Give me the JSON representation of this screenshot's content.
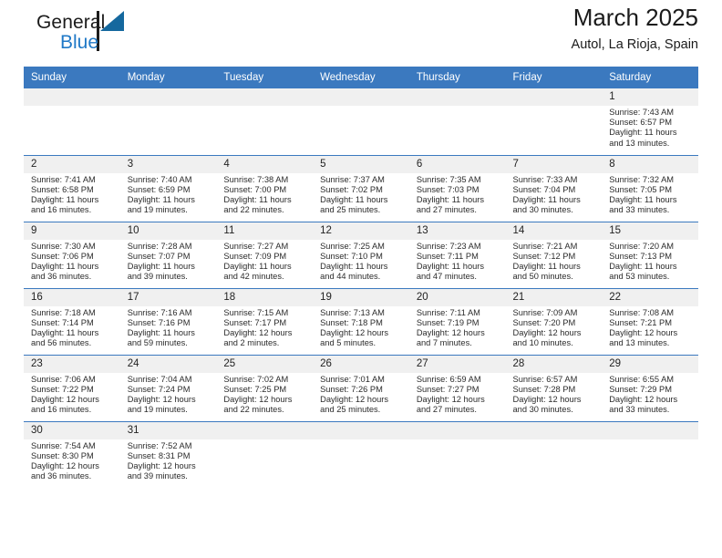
{
  "brand": {
    "name_part1": "General",
    "name_part2": "Blue"
  },
  "header": {
    "title": "March 2025",
    "location": "Autol, La Rioja, Spain"
  },
  "calendar": {
    "weekday_headers": [
      "Sunday",
      "Monday",
      "Tuesday",
      "Wednesday",
      "Thursday",
      "Friday",
      "Saturday"
    ],
    "colors": {
      "header_blue": "#3b79bf",
      "daynum_background": "#f0f0f0",
      "brand_blue": "#2079c7",
      "logo_flag": "#15689e"
    },
    "weeks": [
      [
        {
          "day": "",
          "empty": true
        },
        {
          "day": "",
          "empty": true
        },
        {
          "day": "",
          "empty": true
        },
        {
          "day": "",
          "empty": true
        },
        {
          "day": "",
          "empty": true
        },
        {
          "day": "",
          "empty": true
        },
        {
          "day": "1",
          "sunrise": "Sunrise: 7:43 AM",
          "sunset": "Sunset: 6:57 PM",
          "daylight_line1": "Daylight: 11 hours",
          "daylight_line2": "and 13 minutes."
        }
      ],
      [
        {
          "day": "2",
          "sunrise": "Sunrise: 7:41 AM",
          "sunset": "Sunset: 6:58 PM",
          "daylight_line1": "Daylight: 11 hours",
          "daylight_line2": "and 16 minutes."
        },
        {
          "day": "3",
          "sunrise": "Sunrise: 7:40 AM",
          "sunset": "Sunset: 6:59 PM",
          "daylight_line1": "Daylight: 11 hours",
          "daylight_line2": "and 19 minutes."
        },
        {
          "day": "4",
          "sunrise": "Sunrise: 7:38 AM",
          "sunset": "Sunset: 7:00 PM",
          "daylight_line1": "Daylight: 11 hours",
          "daylight_line2": "and 22 minutes."
        },
        {
          "day": "5",
          "sunrise": "Sunrise: 7:37 AM",
          "sunset": "Sunset: 7:02 PM",
          "daylight_line1": "Daylight: 11 hours",
          "daylight_line2": "and 25 minutes."
        },
        {
          "day": "6",
          "sunrise": "Sunrise: 7:35 AM",
          "sunset": "Sunset: 7:03 PM",
          "daylight_line1": "Daylight: 11 hours",
          "daylight_line2": "and 27 minutes."
        },
        {
          "day": "7",
          "sunrise": "Sunrise: 7:33 AM",
          "sunset": "Sunset: 7:04 PM",
          "daylight_line1": "Daylight: 11 hours",
          "daylight_line2": "and 30 minutes."
        },
        {
          "day": "8",
          "sunrise": "Sunrise: 7:32 AM",
          "sunset": "Sunset: 7:05 PM",
          "daylight_line1": "Daylight: 11 hours",
          "daylight_line2": "and 33 minutes."
        }
      ],
      [
        {
          "day": "9",
          "sunrise": "Sunrise: 7:30 AM",
          "sunset": "Sunset: 7:06 PM",
          "daylight_line1": "Daylight: 11 hours",
          "daylight_line2": "and 36 minutes."
        },
        {
          "day": "10",
          "sunrise": "Sunrise: 7:28 AM",
          "sunset": "Sunset: 7:07 PM",
          "daylight_line1": "Daylight: 11 hours",
          "daylight_line2": "and 39 minutes."
        },
        {
          "day": "11",
          "sunrise": "Sunrise: 7:27 AM",
          "sunset": "Sunset: 7:09 PM",
          "daylight_line1": "Daylight: 11 hours",
          "daylight_line2": "and 42 minutes."
        },
        {
          "day": "12",
          "sunrise": "Sunrise: 7:25 AM",
          "sunset": "Sunset: 7:10 PM",
          "daylight_line1": "Daylight: 11 hours",
          "daylight_line2": "and 44 minutes."
        },
        {
          "day": "13",
          "sunrise": "Sunrise: 7:23 AM",
          "sunset": "Sunset: 7:11 PM",
          "daylight_line1": "Daylight: 11 hours",
          "daylight_line2": "and 47 minutes."
        },
        {
          "day": "14",
          "sunrise": "Sunrise: 7:21 AM",
          "sunset": "Sunset: 7:12 PM",
          "daylight_line1": "Daylight: 11 hours",
          "daylight_line2": "and 50 minutes."
        },
        {
          "day": "15",
          "sunrise": "Sunrise: 7:20 AM",
          "sunset": "Sunset: 7:13 PM",
          "daylight_line1": "Daylight: 11 hours",
          "daylight_line2": "and 53 minutes."
        }
      ],
      [
        {
          "day": "16",
          "sunrise": "Sunrise: 7:18 AM",
          "sunset": "Sunset: 7:14 PM",
          "daylight_line1": "Daylight: 11 hours",
          "daylight_line2": "and 56 minutes."
        },
        {
          "day": "17",
          "sunrise": "Sunrise: 7:16 AM",
          "sunset": "Sunset: 7:16 PM",
          "daylight_line1": "Daylight: 11 hours",
          "daylight_line2": "and 59 minutes."
        },
        {
          "day": "18",
          "sunrise": "Sunrise: 7:15 AM",
          "sunset": "Sunset: 7:17 PM",
          "daylight_line1": "Daylight: 12 hours",
          "daylight_line2": "and 2 minutes."
        },
        {
          "day": "19",
          "sunrise": "Sunrise: 7:13 AM",
          "sunset": "Sunset: 7:18 PM",
          "daylight_line1": "Daylight: 12 hours",
          "daylight_line2": "and 5 minutes."
        },
        {
          "day": "20",
          "sunrise": "Sunrise: 7:11 AM",
          "sunset": "Sunset: 7:19 PM",
          "daylight_line1": "Daylight: 12 hours",
          "daylight_line2": "and 7 minutes."
        },
        {
          "day": "21",
          "sunrise": "Sunrise: 7:09 AM",
          "sunset": "Sunset: 7:20 PM",
          "daylight_line1": "Daylight: 12 hours",
          "daylight_line2": "and 10 minutes."
        },
        {
          "day": "22",
          "sunrise": "Sunrise: 7:08 AM",
          "sunset": "Sunset: 7:21 PM",
          "daylight_line1": "Daylight: 12 hours",
          "daylight_line2": "and 13 minutes."
        }
      ],
      [
        {
          "day": "23",
          "sunrise": "Sunrise: 7:06 AM",
          "sunset": "Sunset: 7:22 PM",
          "daylight_line1": "Daylight: 12 hours",
          "daylight_line2": "and 16 minutes."
        },
        {
          "day": "24",
          "sunrise": "Sunrise: 7:04 AM",
          "sunset": "Sunset: 7:24 PM",
          "daylight_line1": "Daylight: 12 hours",
          "daylight_line2": "and 19 minutes."
        },
        {
          "day": "25",
          "sunrise": "Sunrise: 7:02 AM",
          "sunset": "Sunset: 7:25 PM",
          "daylight_line1": "Daylight: 12 hours",
          "daylight_line2": "and 22 minutes."
        },
        {
          "day": "26",
          "sunrise": "Sunrise: 7:01 AM",
          "sunset": "Sunset: 7:26 PM",
          "daylight_line1": "Daylight: 12 hours",
          "daylight_line2": "and 25 minutes."
        },
        {
          "day": "27",
          "sunrise": "Sunrise: 6:59 AM",
          "sunset": "Sunset: 7:27 PM",
          "daylight_line1": "Daylight: 12 hours",
          "daylight_line2": "and 27 minutes."
        },
        {
          "day": "28",
          "sunrise": "Sunrise: 6:57 AM",
          "sunset": "Sunset: 7:28 PM",
          "daylight_line1": "Daylight: 12 hours",
          "daylight_line2": "and 30 minutes."
        },
        {
          "day": "29",
          "sunrise": "Sunrise: 6:55 AM",
          "sunset": "Sunset: 7:29 PM",
          "daylight_line1": "Daylight: 12 hours",
          "daylight_line2": "and 33 minutes."
        }
      ],
      [
        {
          "day": "30",
          "sunrise": "Sunrise: 7:54 AM",
          "sunset": "Sunset: 8:30 PM",
          "daylight_line1": "Daylight: 12 hours",
          "daylight_line2": "and 36 minutes."
        },
        {
          "day": "31",
          "sunrise": "Sunrise: 7:52 AM",
          "sunset": "Sunset: 8:31 PM",
          "daylight_line1": "Daylight: 12 hours",
          "daylight_line2": "and 39 minutes."
        },
        {
          "day": "",
          "empty": true
        },
        {
          "day": "",
          "empty": true
        },
        {
          "day": "",
          "empty": true
        },
        {
          "day": "",
          "empty": true
        },
        {
          "day": "",
          "empty": true
        }
      ]
    ]
  }
}
